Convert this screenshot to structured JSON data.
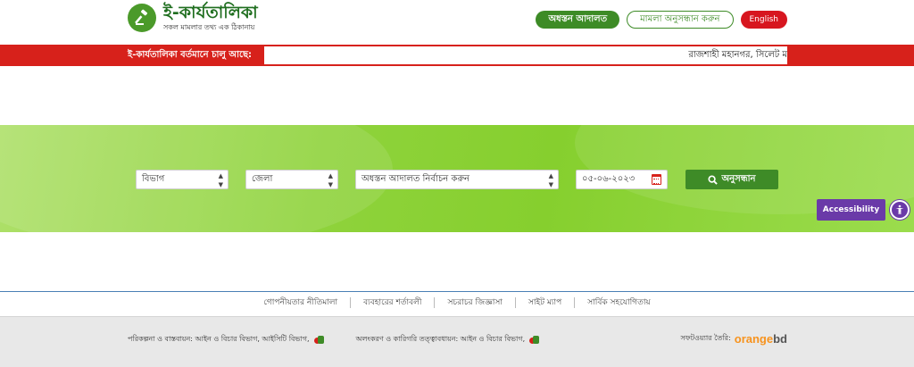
{
  "header": {
    "logo_title": "ই-কার্যতালিকা",
    "logo_subtitle": "সকল মামলার তথ্য এক ঠিকানায়",
    "lower_court_button": "অধস্তন আদালত",
    "case_search_button": "মামলা অনুসন্ধান করুন",
    "language_button": "English"
  },
  "ticker": {
    "label": "ই-কার্যতালিকা বর্তমানে চালু আছে:",
    "text": "রাজশাহী মহানগর, সিলেট ম"
  },
  "search": {
    "division_select": "বিভাগ",
    "district_select": "জেলা",
    "court_select": "অধস্তন আদালত নির্বাচন করুন",
    "date_value": "০৫-০৬-২০২৩",
    "search_button": "অনুসন্ধান"
  },
  "accessibility": {
    "label": "Accessibility"
  },
  "footer": {
    "links": [
      "গোপনীয়তার নীতিমালা",
      "ব্যবহারের শর্তাবলী",
      "সচরাচর জিজ্ঞাসা",
      "সাইট ম্যাপ",
      "সার্বিক সহযোগিতায়"
    ],
    "planning": "পরিকল্পনা ও বাস্তবায়ন: আইন ও বিচার বিভাগ, আইসিটি বিভাগ,",
    "supervision": "অলংকরণ ও কারিগরি তত্ত্বাবধায়ন: আইন ও বিচার বিভাগ,",
    "made_by_label": "সফটওয়্যার তৈরি:",
    "made_by_brand_a": "orange",
    "made_by_brand_b": "bd"
  },
  "colors": {
    "brand_green": "#3d8b26",
    "ticker_red": "#d7211b",
    "accessibility_purple": "#6a3aa8"
  }
}
